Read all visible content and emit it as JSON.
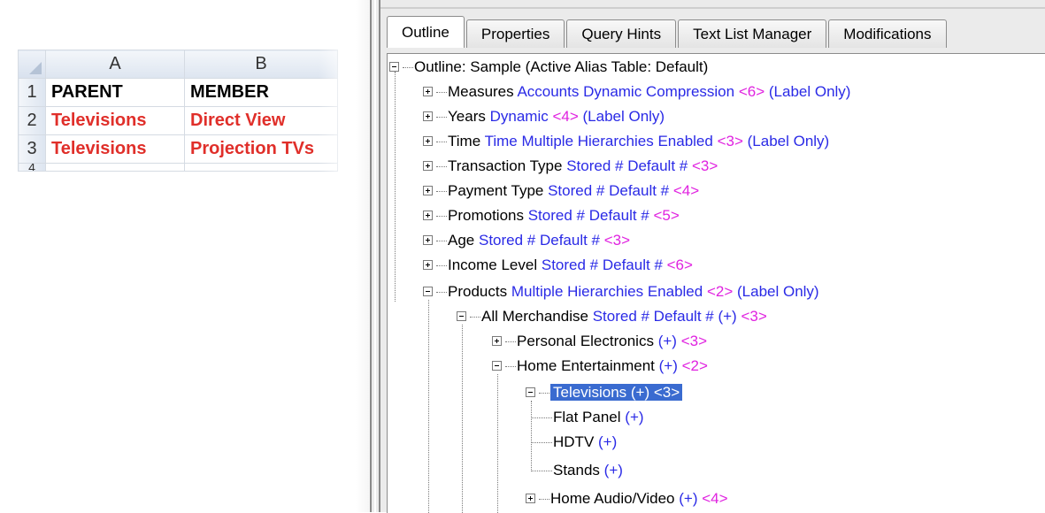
{
  "spreadsheet": {
    "col_a": "A",
    "col_b": "B",
    "rows": [
      {
        "num": "1",
        "a": "PARENT",
        "b": "MEMBER"
      },
      {
        "num": "2",
        "a": "Televisions",
        "b": "Direct View"
      },
      {
        "num": "3",
        "a": "Televisions",
        "b": "Projection TVs"
      },
      {
        "num": "4",
        "a": "",
        "b": ""
      }
    ]
  },
  "tabs": [
    {
      "label": "Outline"
    },
    {
      "label": "Properties"
    },
    {
      "label": "Query Hints"
    },
    {
      "label": "Text List Manager"
    },
    {
      "label": "Modifications"
    }
  ],
  "tree": {
    "root": "Outline: Sample (Active Alias Table: Default)",
    "dimensions": [
      {
        "name": "Measures",
        "blue": "Accounts Dynamic  Compression",
        "mag": "<6>",
        "tail": "(Label Only)"
      },
      {
        "name": "Years",
        "blue": "Dynamic ",
        "mag": "<4>",
        "tail": "(Label Only)"
      },
      {
        "name": "Time",
        "blue": "Time Multiple Hierarchies Enabled",
        "mag": "<3>",
        "tail": "(Label Only)"
      },
      {
        "name": "Transaction Type",
        "blue": "Stored # Default #",
        "mag": "<3>",
        "tail": ""
      },
      {
        "name": "Payment Type",
        "blue": "Stored # Default #",
        "mag": "<4>",
        "tail": ""
      },
      {
        "name": "Promotions",
        "blue": "Stored # Default #",
        "mag": "<5>",
        "tail": ""
      },
      {
        "name": "Age",
        "blue": "Stored # Default #",
        "mag": "<3>",
        "tail": ""
      },
      {
        "name": "Income Level",
        "blue": "Stored # Default #",
        "mag": "<6>",
        "tail": ""
      },
      {
        "name": "Products",
        "blue": "Multiple Hierarchies Enabled",
        "mag": "<2>",
        "tail": "(Label Only)"
      }
    ],
    "all_merchandise": {
      "name": "All Merchandise",
      "blue": "Stored # Default # (+)",
      "mag": "<3>"
    },
    "personal_electronics": {
      "name": "Personal Electronics",
      "blue": "(+)",
      "mag": "<3>"
    },
    "home_entertainment": {
      "name": "Home Entertainment",
      "blue": "(+)",
      "mag": "<2>"
    },
    "televisions": {
      "label": "Televisions (+) <3>"
    },
    "tv_children": [
      {
        "name": "Flat Panel",
        "blue": "(+)"
      },
      {
        "name": "HDTV",
        "blue": "(+)"
      },
      {
        "name": "Stands",
        "blue": "(+)"
      }
    ],
    "home_audio_video": {
      "name": "Home Audio/Video",
      "blue": "(+)",
      "mag": "<4>"
    }
  }
}
